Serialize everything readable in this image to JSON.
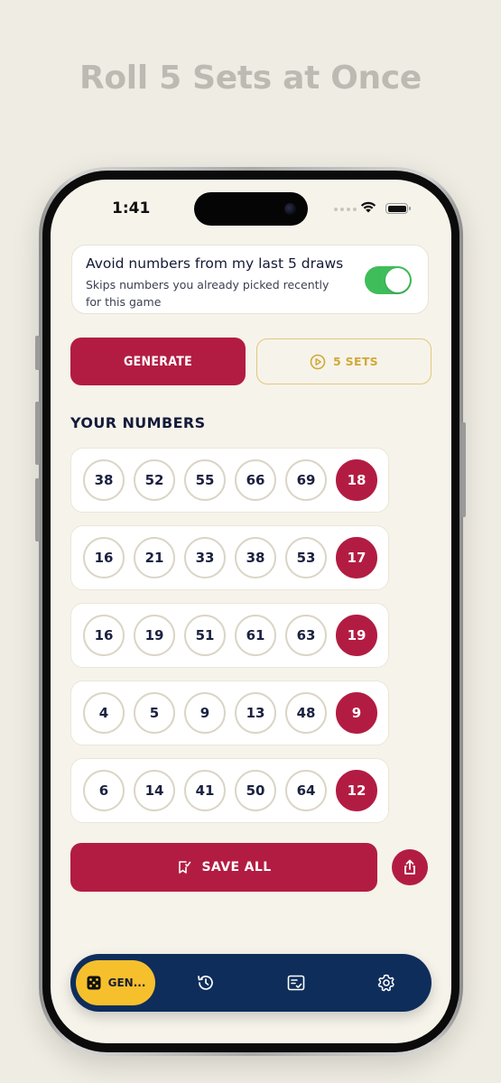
{
  "headline": "Roll 5 Sets at Once",
  "status": {
    "time": "1:41"
  },
  "avoid": {
    "title": "Avoid numbers from my last 5 draws",
    "subtitle": "Skips numbers you already picked recently for this game",
    "enabled": true
  },
  "actions": {
    "generate": "GENERATE",
    "sets": "5 SETS"
  },
  "section_title": "YOUR NUMBERS",
  "sets": [
    {
      "main": [
        38,
        52,
        55,
        66,
        69
      ],
      "bonus": 18
    },
    {
      "main": [
        16,
        21,
        33,
        38,
        53
      ],
      "bonus": 17
    },
    {
      "main": [
        16,
        19,
        51,
        61,
        63
      ],
      "bonus": 19
    },
    {
      "main": [
        4,
        5,
        9,
        13,
        48
      ],
      "bonus": 9
    },
    {
      "main": [
        6,
        14,
        41,
        50,
        64
      ],
      "bonus": 12
    }
  ],
  "save_all": "SAVE ALL",
  "nav": {
    "active_label": "GEN...",
    "items": [
      "dice-icon",
      "history-icon",
      "checklist-icon",
      "settings-icon"
    ]
  },
  "colors": {
    "accent": "#b31c42",
    "gold": "#d1a838",
    "nav_bg": "#0e2d5b",
    "nav_active": "#f6c02d",
    "toggle_on": "#3fbd5a"
  }
}
